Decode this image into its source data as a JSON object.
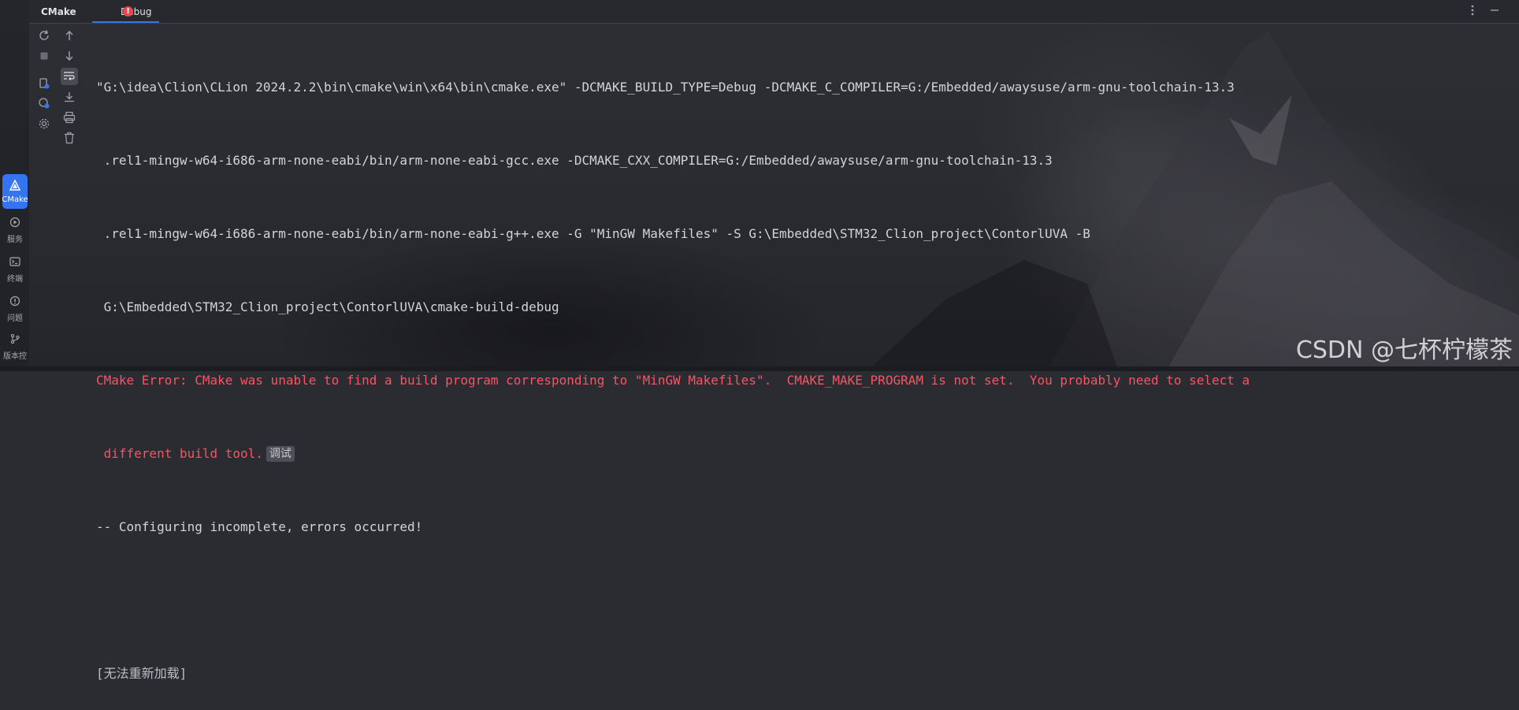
{
  "header": {
    "title": "CMake",
    "tab_label": "Debug",
    "tab_error_glyph": "!"
  },
  "sidebar": {
    "items": [
      {
        "label": "CMake",
        "icon": "cmake-icon"
      },
      {
        "label": "服务",
        "icon": "services-icon"
      },
      {
        "label": "终端",
        "icon": "terminal-icon"
      },
      {
        "label": "问题",
        "icon": "problems-icon"
      },
      {
        "label": "版本控",
        "icon": "vcs-icon"
      }
    ]
  },
  "console": {
    "lines": [
      {
        "text": "\"G:\\idea\\Clion\\CLion 2024.2.2\\bin\\cmake\\win\\x64\\bin\\cmake.exe\" -DCMAKE_BUILD_TYPE=Debug -DCMAKE_C_COMPILER=G:/Embedded/awaysuse/arm-gnu-toolchain-13.3",
        "kind": "normal"
      },
      {
        "text": " .rel1-mingw-w64-i686-arm-none-eabi/bin/arm-none-eabi-gcc.exe -DCMAKE_CXX_COMPILER=G:/Embedded/awaysuse/arm-gnu-toolchain-13.3",
        "kind": "normal"
      },
      {
        "text": " .rel1-mingw-w64-i686-arm-none-eabi/bin/arm-none-eabi-g++.exe -G \"MinGW Makefiles\" -S G:\\Embedded\\STM32_Clion_project\\ContorlUVA -B",
        "kind": "normal"
      },
      {
        "text": " G:\\Embedded\\STM32_Clion_project\\ContorlUVA\\cmake-build-debug",
        "kind": "normal"
      },
      {
        "text": "CMake Error: CMake was unable to find a build program corresponding to \"MinGW Makefiles\".  CMAKE_MAKE_PROGRAM is not set.  You probably need to select a",
        "kind": "error"
      },
      {
        "text": " different build tool.",
        "kind": "error"
      },
      {
        "text": "-- Configuring incomplete, errors occurred!",
        "kind": "normal"
      },
      {
        "text": "",
        "kind": "blank"
      },
      {
        "text": "[无法重新加载]",
        "kind": "reload"
      }
    ],
    "debug_hint": "调试"
  },
  "watermark": "CSDN @七杯柠檬茶",
  "colors": {
    "accent": "#3574f0",
    "error_text": "#f75464",
    "error_badge": "#e5484d"
  }
}
